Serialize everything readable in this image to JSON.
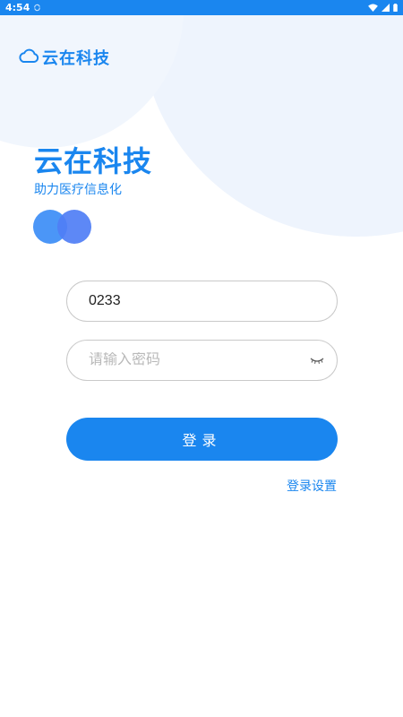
{
  "status_bar": {
    "time": "4:54",
    "icons": [
      "sync-icon",
      "wifi-icon",
      "signal-icon",
      "battery-icon"
    ]
  },
  "brand": {
    "logo_text": "云在科技",
    "logo_icon": "cloud-icon"
  },
  "hero": {
    "title": "云在科技",
    "subtitle": "助力医疗信息化"
  },
  "form": {
    "username_value": "0233",
    "password_value": "",
    "password_placeholder": "请输入密码",
    "password_toggle_icon": "eye-closed-icon"
  },
  "actions": {
    "login_label": "登录",
    "settings_link": "登录设置"
  },
  "colors": {
    "accent": "#1a86ef",
    "status_bar": "#1a86ef",
    "background_circle": "#eef4fd",
    "input_border": "#c9c9c9",
    "placeholder": "#b9b9b9"
  }
}
